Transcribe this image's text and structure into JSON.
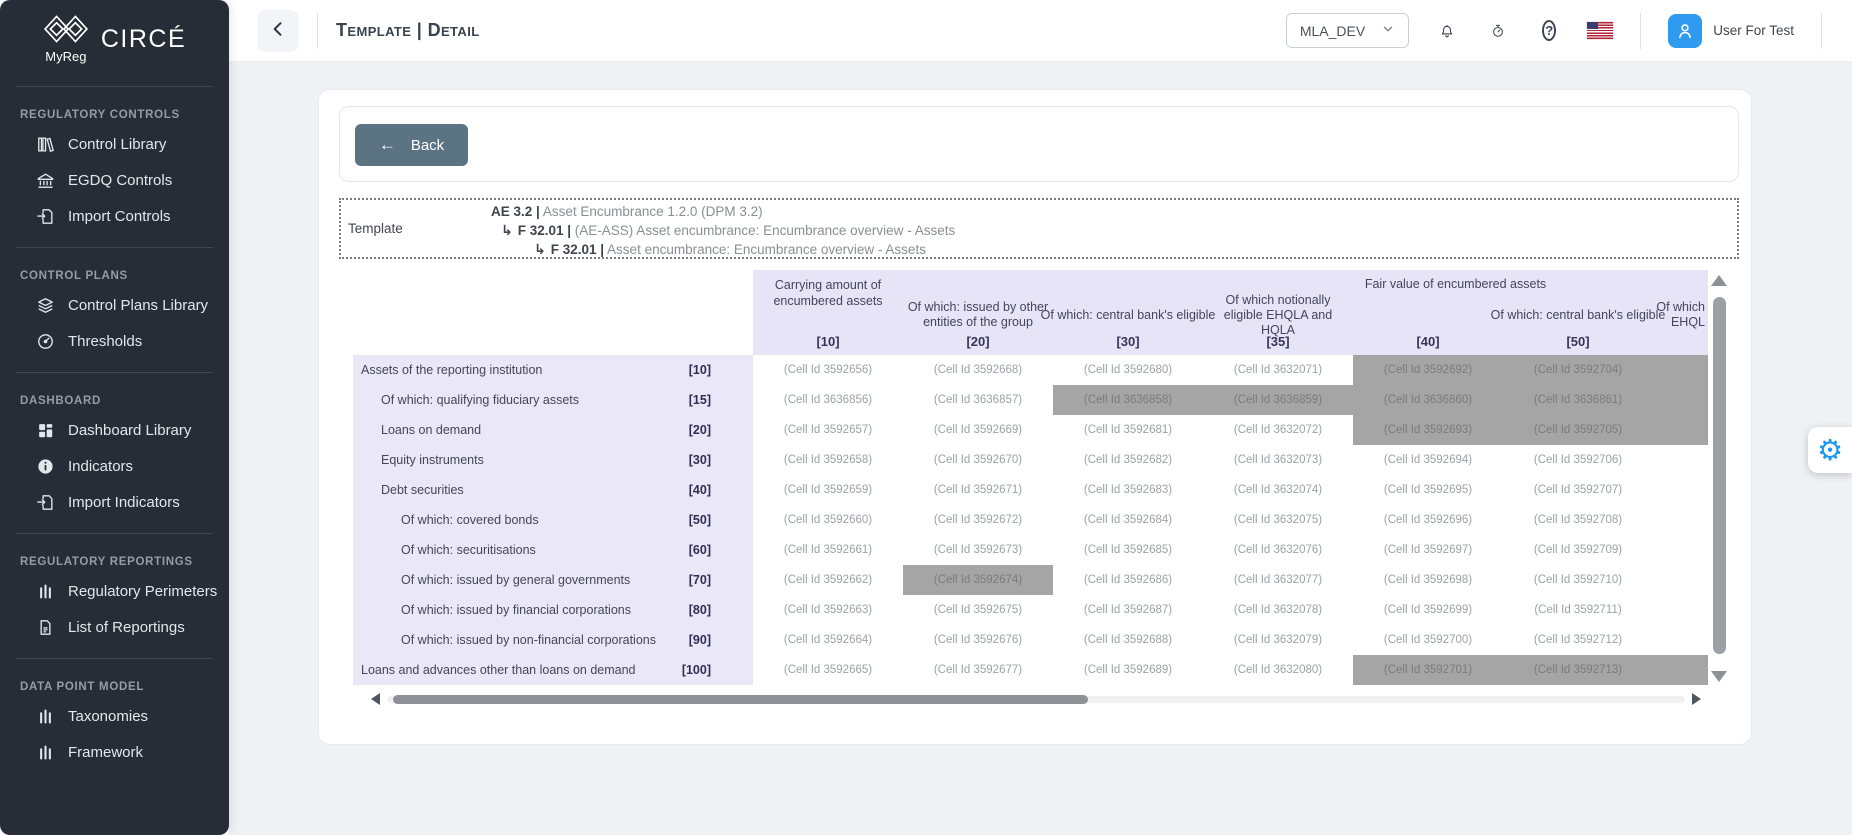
{
  "app": {
    "name": "CIRCÉ",
    "logo_caption": "MyReg"
  },
  "topbar": {
    "breadcrumb": "Template | Detail",
    "environment": "MLA_DEV",
    "user": "User For Test"
  },
  "sidebar": {
    "sections": [
      {
        "title": "Regulatory Controls",
        "items": [
          {
            "icon": "books-icon",
            "label": "Control Library"
          },
          {
            "icon": "bank-icon",
            "label": "EGDQ Controls"
          },
          {
            "icon": "file-import-icon",
            "label": "Import Controls"
          }
        ]
      },
      {
        "title": "Control Plans",
        "items": [
          {
            "icon": "layers-icon",
            "label": "Control Plans Library"
          },
          {
            "icon": "gauge-icon",
            "label": "Thresholds"
          }
        ]
      },
      {
        "title": "Dashboard",
        "items": [
          {
            "icon": "grid-icon",
            "label": "Dashboard Library"
          },
          {
            "icon": "info-icon",
            "label": "Indicators"
          },
          {
            "icon": "file-import-icon",
            "label": "Import Indicators"
          }
        ]
      },
      {
        "title": "Regulatory Reportings",
        "items": [
          {
            "icon": "bars-icon",
            "label": "Regulatory Perimeters"
          },
          {
            "icon": "doc-icon",
            "label": "List of Reportings"
          }
        ]
      },
      {
        "title": "Data Point Model",
        "items": [
          {
            "icon": "bars-icon",
            "label": "Taxonomies"
          },
          {
            "icon": "bars-icon",
            "label": "Framework"
          }
        ]
      }
    ]
  },
  "content": {
    "back_label": "Back",
    "template_info": {
      "label": "Template",
      "lines": [
        {
          "code": "AE 3.2 |",
          "desc": "Asset Encumbrance 1.2.0 (DPM 3.2)"
        },
        {
          "code": "F 32.01 |",
          "desc": "(AE-ASS) Asset encumbrance: Encumbrance overview - Assets"
        },
        {
          "code": "F 32.01 |",
          "desc": "Asset encumbrance: Encumbrance overview - Assets"
        }
      ]
    }
  },
  "table": {
    "group_header": "Fair value of encumbered assets",
    "columns": [
      {
        "top": "Carrying amount of encumbered assets",
        "sub": "",
        "code": "[10]"
      },
      {
        "top": "",
        "sub": "Of which: issued by other entities of the group",
        "code": "[20]"
      },
      {
        "top": "",
        "sub": "Of which: central bank's eligible",
        "code": "[30]"
      },
      {
        "top": "",
        "sub": "Of which notionally eligible EHQLA and HQLA",
        "code": "[35]"
      },
      {
        "top": "",
        "sub": "",
        "code": "[40]"
      },
      {
        "top": "",
        "sub": "Of which: central bank's eligible",
        "code": "[50]"
      },
      {
        "top": "",
        "sub": "Of which EHQL",
        "code": "",
        "partial": true
      }
    ],
    "rows": [
      {
        "label": "Assets of the reporting institution",
        "code": "[10]",
        "indent": 0,
        "cells": [
          [
            "(Cell Id 3592656)",
            0
          ],
          [
            "(Cell Id 3592668)",
            0
          ],
          [
            "(Cell Id 3592680)",
            0
          ],
          [
            "(Cell Id 3632071)",
            0
          ],
          [
            "(Cell Id 3592692)",
            1
          ],
          [
            "(Cell Id 3592704)",
            1
          ]
        ]
      },
      {
        "label": "Of which: qualifying fiduciary assets",
        "code": "[15]",
        "indent": 1,
        "cells": [
          [
            "(Cell Id 3636856)",
            0
          ],
          [
            "(Cell Id 3636857)",
            0
          ],
          [
            "(Cell Id 3636858)",
            1
          ],
          [
            "(Cell Id 3636859)",
            1
          ],
          [
            "(Cell Id 3636860)",
            1
          ],
          [
            "(Cell Id 3636861)",
            1
          ]
        ]
      },
      {
        "label": "Loans on demand",
        "code": "[20]",
        "indent": 1,
        "cells": [
          [
            "(Cell Id 3592657)",
            0
          ],
          [
            "(Cell Id 3592669)",
            0
          ],
          [
            "(Cell Id 3592681)",
            0
          ],
          [
            "(Cell Id 3632072)",
            0
          ],
          [
            "(Cell Id 3592693)",
            1
          ],
          [
            "(Cell Id 3592705)",
            1
          ]
        ]
      },
      {
        "label": "Equity instruments",
        "code": "[30]",
        "indent": 1,
        "cells": [
          [
            "(Cell Id 3592658)",
            0
          ],
          [
            "(Cell Id 3592670)",
            0
          ],
          [
            "(Cell Id 3592682)",
            0
          ],
          [
            "(Cell Id 3632073)",
            0
          ],
          [
            "(Cell Id 3592694)",
            0
          ],
          [
            "(Cell Id 3592706)",
            0
          ]
        ]
      },
      {
        "label": "Debt securities",
        "code": "[40]",
        "indent": 1,
        "cells": [
          [
            "(Cell Id 3592659)",
            0
          ],
          [
            "(Cell Id 3592671)",
            0
          ],
          [
            "(Cell Id 3592683)",
            0
          ],
          [
            "(Cell Id 3632074)",
            0
          ],
          [
            "(Cell Id 3592695)",
            0
          ],
          [
            "(Cell Id 3592707)",
            0
          ]
        ]
      },
      {
        "label": "Of which: covered bonds",
        "code": "[50]",
        "indent": 2,
        "cells": [
          [
            "(Cell Id 3592660)",
            0
          ],
          [
            "(Cell Id 3592672)",
            0
          ],
          [
            "(Cell Id 3592684)",
            0
          ],
          [
            "(Cell Id 3632075)",
            0
          ],
          [
            "(Cell Id 3592696)",
            0
          ],
          [
            "(Cell Id 3592708)",
            0
          ]
        ]
      },
      {
        "label": "Of which: securitisations",
        "code": "[60]",
        "indent": 2,
        "cells": [
          [
            "(Cell Id 3592661)",
            0
          ],
          [
            "(Cell Id 3592673)",
            0
          ],
          [
            "(Cell Id 3592685)",
            0
          ],
          [
            "(Cell Id 3632076)",
            0
          ],
          [
            "(Cell Id 3592697)",
            0
          ],
          [
            "(Cell Id 3592709)",
            0
          ]
        ]
      },
      {
        "label": "Of which: issued by general governments",
        "code": "[70]",
        "indent": 2,
        "cells": [
          [
            "(Cell Id 3592662)",
            0
          ],
          [
            "(Cell Id 3592674)",
            1
          ],
          [
            "(Cell Id 3592686)",
            0
          ],
          [
            "(Cell Id 3632077)",
            0
          ],
          [
            "(Cell Id 3592698)",
            0
          ],
          [
            "(Cell Id 3592710)",
            0
          ]
        ]
      },
      {
        "label": "Of which: issued by financial corporations",
        "code": "[80]",
        "indent": 2,
        "cells": [
          [
            "(Cell Id 3592663)",
            0
          ],
          [
            "(Cell Id 3592675)",
            0
          ],
          [
            "(Cell Id 3592687)",
            0
          ],
          [
            "(Cell Id 3632078)",
            0
          ],
          [
            "(Cell Id 3592699)",
            0
          ],
          [
            "(Cell Id 3592711)",
            0
          ]
        ]
      },
      {
        "label": "Of which: issued by non-financial corporations",
        "code": "[90]",
        "indent": 2,
        "cells": [
          [
            "(Cell Id 3592664)",
            0
          ],
          [
            "(Cell Id 3592676)",
            0
          ],
          [
            "(Cell Id 3592688)",
            0
          ],
          [
            "(Cell Id 3632079)",
            0
          ],
          [
            "(Cell Id 3592700)",
            0
          ],
          [
            "(Cell Id 3592712)",
            0
          ]
        ]
      },
      {
        "label": "Loans and advances other than loans on demand",
        "code": "[100]",
        "indent": 0,
        "cells": [
          [
            "(Cell Id 3592665)",
            0
          ],
          [
            "(Cell Id 3592677)",
            0
          ],
          [
            "(Cell Id 3592689)",
            0
          ],
          [
            "(Cell Id 3632080)",
            0
          ],
          [
            "(Cell Id 3592701)",
            1
          ],
          [
            "(Cell Id 3592713)",
            1
          ]
        ]
      }
    ]
  },
  "colors": {
    "accent_blue": "#2e9bf0",
    "sidebar_bg": "#262d36",
    "header_lavender": "#e6e4f6",
    "label_lavender": "#e9e7f8",
    "blocked_cell": "#a5a5a5",
    "back_button": "#5b7383"
  }
}
